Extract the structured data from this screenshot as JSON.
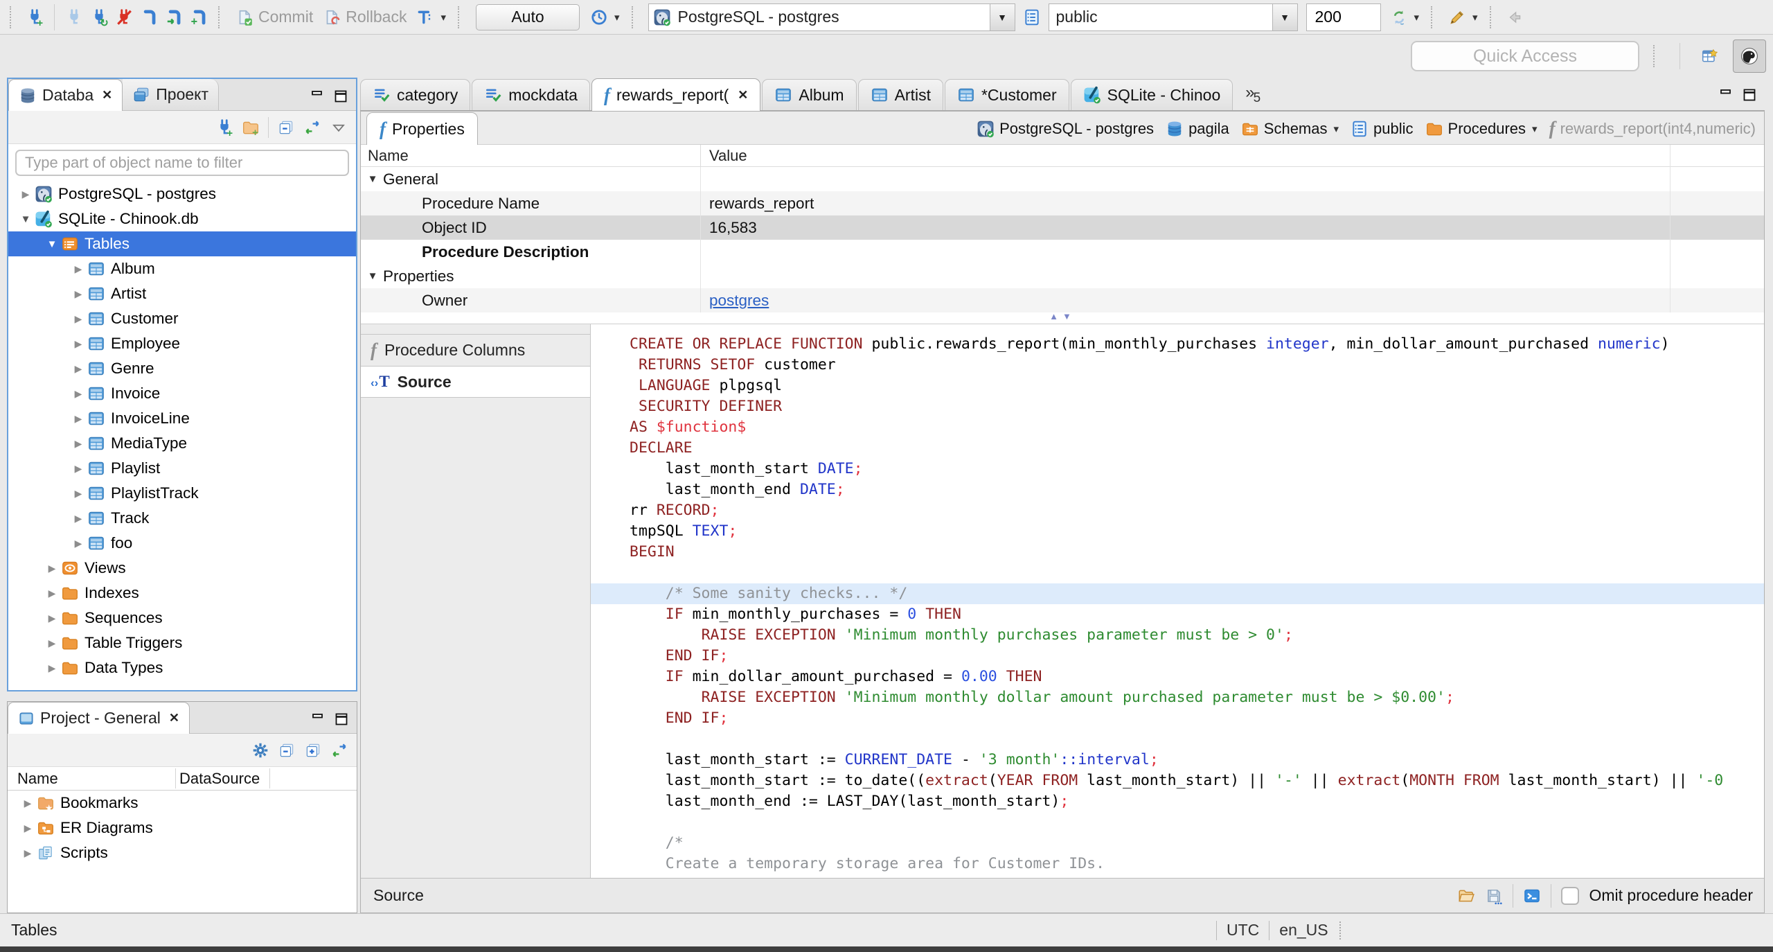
{
  "toolbar": {
    "commit": "Commit",
    "rollback": "Rollback",
    "auto": "Auto",
    "connection": "PostgreSQL - postgres",
    "schema": "public",
    "fetch_size": "200",
    "quick_access": "Quick Access"
  },
  "nav": {
    "tabs": [
      {
        "label": "Databa",
        "icon": "dbstack",
        "active": true,
        "closable": true
      },
      {
        "label": "Проект",
        "icon": "windows"
      }
    ],
    "filter_placeholder": "Type part of object name to filter",
    "tree": [
      {
        "label": "PostgreSQL - postgres",
        "icon": "pg",
        "depth": 0,
        "state": "collapsed"
      },
      {
        "label": "SQLite - Chinook.db",
        "icon": "sqlite",
        "depth": 0,
        "state": "expanded"
      },
      {
        "label": "Tables",
        "icon": "tables",
        "depth": 1,
        "state": "expanded",
        "selected": true
      },
      {
        "label": "Album",
        "icon": "table",
        "depth": 2,
        "state": "collapsed"
      },
      {
        "label": "Artist",
        "icon": "table",
        "depth": 2,
        "state": "collapsed"
      },
      {
        "label": "Customer",
        "icon": "table",
        "depth": 2,
        "state": "collapsed"
      },
      {
        "label": "Employee",
        "icon": "table",
        "depth": 2,
        "state": "collapsed"
      },
      {
        "label": "Genre",
        "icon": "table",
        "depth": 2,
        "state": "collapsed"
      },
      {
        "label": "Invoice",
        "icon": "table",
        "depth": 2,
        "state": "collapsed"
      },
      {
        "label": "InvoiceLine",
        "icon": "table",
        "depth": 2,
        "state": "collapsed"
      },
      {
        "label": "MediaType",
        "icon": "table",
        "depth": 2,
        "state": "collapsed"
      },
      {
        "label": "Playlist",
        "icon": "table",
        "depth": 2,
        "state": "collapsed"
      },
      {
        "label": "PlaylistTrack",
        "icon": "table",
        "depth": 2,
        "state": "collapsed"
      },
      {
        "label": "Track",
        "icon": "table",
        "depth": 2,
        "state": "collapsed"
      },
      {
        "label": "foo",
        "icon": "table",
        "depth": 2,
        "state": "collapsed"
      },
      {
        "label": "Views",
        "icon": "views",
        "depth": 1,
        "state": "collapsed"
      },
      {
        "label": "Indexes",
        "icon": "folder",
        "depth": 1,
        "state": "collapsed"
      },
      {
        "label": "Sequences",
        "icon": "folder",
        "depth": 1,
        "state": "collapsed"
      },
      {
        "label": "Table Triggers",
        "icon": "folder",
        "depth": 1,
        "state": "collapsed"
      },
      {
        "label": "Data Types",
        "icon": "folder",
        "depth": 1,
        "state": "collapsed"
      }
    ]
  },
  "project": {
    "title": "Project - General",
    "columns": [
      "Name",
      "DataSource"
    ],
    "items": [
      {
        "label": "Bookmarks",
        "icon": "folder-star"
      },
      {
        "label": "ER Diagrams",
        "icon": "folder-er"
      },
      {
        "label": "Scripts",
        "icon": "scripts"
      }
    ]
  },
  "editor": {
    "tabs": [
      {
        "label": "category",
        "icon": "script"
      },
      {
        "label": "mockdata",
        "icon": "script"
      },
      {
        "label": "rewards_report(",
        "icon": "fblue",
        "active": true,
        "closable": true
      },
      {
        "label": "Album",
        "icon": "table"
      },
      {
        "label": "Artist",
        "icon": "table"
      },
      {
        "label": "*Customer",
        "icon": "table"
      },
      {
        "label": "SQLite - Chinoo",
        "icon": "sqlite"
      }
    ],
    "overflow": "5",
    "properties_tab": "Properties",
    "breadcrumb": [
      {
        "label": "PostgreSQL - postgres",
        "icon": "pg"
      },
      {
        "label": "pagila",
        "icon": "dbblue"
      },
      {
        "label": "Schemas",
        "icon": "schemas-folder",
        "dropdown": true
      },
      {
        "label": "public",
        "icon": "schema-page"
      },
      {
        "label": "Procedures",
        "icon": "folder",
        "dropdown": true
      },
      {
        "label": "rewards_report(int4,numeric)",
        "icon": "fgray",
        "muted": true
      }
    ],
    "grid": {
      "columns": [
        "Name",
        "Value"
      ],
      "rows": [
        {
          "name": "General",
          "group": true
        },
        {
          "name": "Procedure Name",
          "value": "rewards_report",
          "shade": true
        },
        {
          "name": "Object ID",
          "value": "16,583",
          "selected": true
        },
        {
          "name": "Procedure Description",
          "bold": true
        },
        {
          "name": "Properties",
          "group": true
        },
        {
          "name": "Owner",
          "value": "postgres",
          "link": true,
          "shade": true
        }
      ]
    },
    "side_tabs": [
      {
        "label": "Procedure Columns",
        "icon": "fgray"
      },
      {
        "label": "Source",
        "icon": "source",
        "active": true
      }
    ],
    "bottom": {
      "label": "Source",
      "checkbox": "Omit procedure header"
    }
  },
  "code": {
    "lines": [
      {
        "seg": [
          [
            "kw",
            "CREATE OR REPLACE FUNCTION"
          ],
          [
            "pl",
            " public.rewards_report(min_monthly_purchases "
          ],
          [
            "ty",
            "integer"
          ],
          [
            "pl",
            ", min_dollar_amount_purchased "
          ],
          [
            "ty",
            "numeric"
          ],
          [
            "pl",
            ")"
          ]
        ]
      },
      {
        "seg": [
          [
            "pl",
            " "
          ],
          [
            "kw",
            "RETURNS SETOF"
          ],
          [
            "pl",
            " customer"
          ]
        ]
      },
      {
        "seg": [
          [
            "pl",
            " "
          ],
          [
            "kw",
            "LANGUAGE"
          ],
          [
            "pl",
            " plpgsql"
          ]
        ]
      },
      {
        "seg": [
          [
            "pl",
            " "
          ],
          [
            "kw",
            "SECURITY DEFINER"
          ]
        ]
      },
      {
        "seg": [
          [
            "kw",
            "AS"
          ],
          [
            "pl",
            " "
          ],
          [
            "dl",
            "$function$"
          ]
        ]
      },
      {
        "seg": [
          [
            "kw",
            "DECLARE"
          ]
        ]
      },
      {
        "seg": [
          [
            "pl",
            "    last_month_start "
          ],
          [
            "ty",
            "DATE"
          ],
          [
            "dl",
            ";"
          ]
        ]
      },
      {
        "seg": [
          [
            "pl",
            "    last_month_end "
          ],
          [
            "ty",
            "DATE"
          ],
          [
            "dl",
            ";"
          ]
        ]
      },
      {
        "seg": [
          [
            "pl",
            "rr "
          ],
          [
            "kw",
            "RECORD"
          ],
          [
            "dl",
            ";"
          ]
        ]
      },
      {
        "seg": [
          [
            "pl",
            "tmpSQL "
          ],
          [
            "ty",
            "TEXT"
          ],
          [
            "dl",
            ";"
          ]
        ]
      },
      {
        "seg": [
          [
            "kw",
            "BEGIN"
          ]
        ]
      },
      {
        "seg": []
      },
      {
        "hl": true,
        "seg": [
          [
            "cm",
            "    /* Some sanity checks... */"
          ]
        ]
      },
      {
        "seg": [
          [
            "pl",
            "    "
          ],
          [
            "kw",
            "IF"
          ],
          [
            "pl",
            " min_monthly_purchases = "
          ],
          [
            "nu",
            "0"
          ],
          [
            "pl",
            " "
          ],
          [
            "kw",
            "THEN"
          ]
        ]
      },
      {
        "seg": [
          [
            "pl",
            "        "
          ],
          [
            "kw",
            "RAISE EXCEPTION"
          ],
          [
            "pl",
            " "
          ],
          [
            "st",
            "'Minimum monthly purchases parameter must be > 0'"
          ],
          [
            "dl",
            ";"
          ]
        ]
      },
      {
        "seg": [
          [
            "pl",
            "    "
          ],
          [
            "kw",
            "END IF"
          ],
          [
            "dl",
            ";"
          ]
        ]
      },
      {
        "seg": [
          [
            "pl",
            "    "
          ],
          [
            "kw",
            "IF"
          ],
          [
            "pl",
            " min_dollar_amount_purchased = "
          ],
          [
            "nu",
            "0.00"
          ],
          [
            "pl",
            " "
          ],
          [
            "kw",
            "THEN"
          ]
        ]
      },
      {
        "seg": [
          [
            "pl",
            "        "
          ],
          [
            "kw",
            "RAISE EXCEPTION"
          ],
          [
            "pl",
            " "
          ],
          [
            "st",
            "'Minimum monthly dollar amount purchased parameter must be > $0.00'"
          ],
          [
            "dl",
            ";"
          ]
        ]
      },
      {
        "seg": [
          [
            "pl",
            "    "
          ],
          [
            "kw",
            "END IF"
          ],
          [
            "dl",
            ";"
          ]
        ]
      },
      {
        "seg": []
      },
      {
        "seg": [
          [
            "pl",
            "    last_month_start := "
          ],
          [
            "ty",
            "CURRENT_DATE"
          ],
          [
            "pl",
            " - "
          ],
          [
            "st",
            "'3 month'"
          ],
          [
            "ty",
            "::interval"
          ],
          [
            "dl",
            ";"
          ]
        ]
      },
      {
        "seg": [
          [
            "pl",
            "    last_month_start := to_date(("
          ],
          [
            "kw",
            "extract"
          ],
          [
            "pl",
            "("
          ],
          [
            "kw",
            "YEAR FROM"
          ],
          [
            "pl",
            " last_month_start) || "
          ],
          [
            "st",
            "'-'"
          ],
          [
            "pl",
            " || "
          ],
          [
            "kw",
            "extract"
          ],
          [
            "pl",
            "("
          ],
          [
            "kw",
            "MONTH FROM"
          ],
          [
            "pl",
            " last_month_start) || "
          ],
          [
            "st",
            "'-0"
          ]
        ]
      },
      {
        "seg": [
          [
            "pl",
            "    last_month_end := LAST_DAY(last_month_start)"
          ],
          [
            "dl",
            ";"
          ]
        ]
      },
      {
        "seg": []
      },
      {
        "seg": [
          [
            "cm",
            "    /*"
          ]
        ]
      },
      {
        "seg": [
          [
            "cm",
            "    Create a temporary storage area for Customer IDs."
          ]
        ]
      },
      {
        "seg": [
          [
            "cm",
            "    */"
          ]
        ]
      }
    ]
  },
  "statusbar": {
    "context": "Tables",
    "timezone": "UTC",
    "locale": "en_US"
  }
}
